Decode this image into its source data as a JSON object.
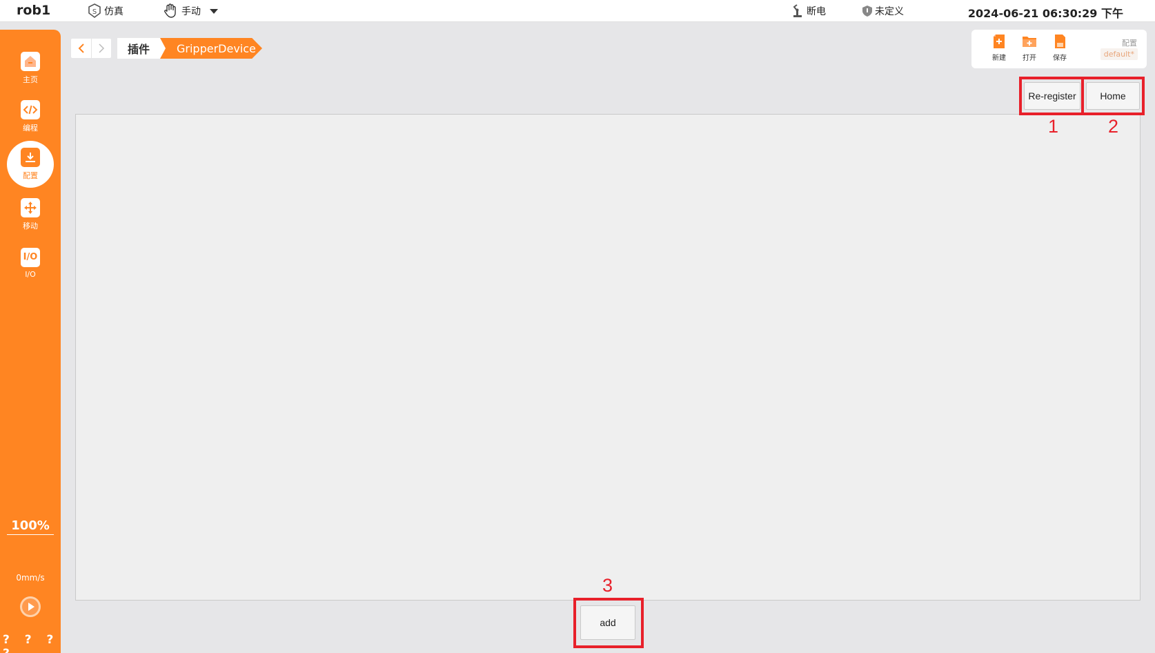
{
  "topbar": {
    "robot_name": "rob1",
    "sim_label": "仿真",
    "mode_label": "手动",
    "power_label": "断电",
    "safety_label": "未定义",
    "clock": "2024-06-21 06:30:29 下午"
  },
  "sidebar": {
    "items": [
      {
        "label": "主页",
        "icon": "home-icon"
      },
      {
        "label": "编程",
        "icon": "code-icon"
      },
      {
        "label": "配置",
        "icon": "config-icon"
      },
      {
        "label": "移动",
        "icon": "move-icon"
      },
      {
        "label": "I/O",
        "icon": "io-icon",
        "glyph": "I/O"
      }
    ],
    "active_index": 2,
    "speed_percent": "100%",
    "speed_value": "0mm/s",
    "footer_text": "? ? ? ?"
  },
  "breadcrumb": {
    "items": [
      "插件",
      "GripperDevice"
    ]
  },
  "config_panel": {
    "new_label": "新建",
    "open_label": "打开",
    "save_label": "保存",
    "config_label": "配置",
    "config_value": "default*"
  },
  "actions": {
    "reregister_label": "Re-register",
    "home_label": "Home",
    "add_label": "add"
  },
  "annotations": [
    "1",
    "2",
    "3"
  ],
  "colors": {
    "accent": "#ff8522",
    "highlight": "#e8202a",
    "background": "#e6e6e8"
  }
}
